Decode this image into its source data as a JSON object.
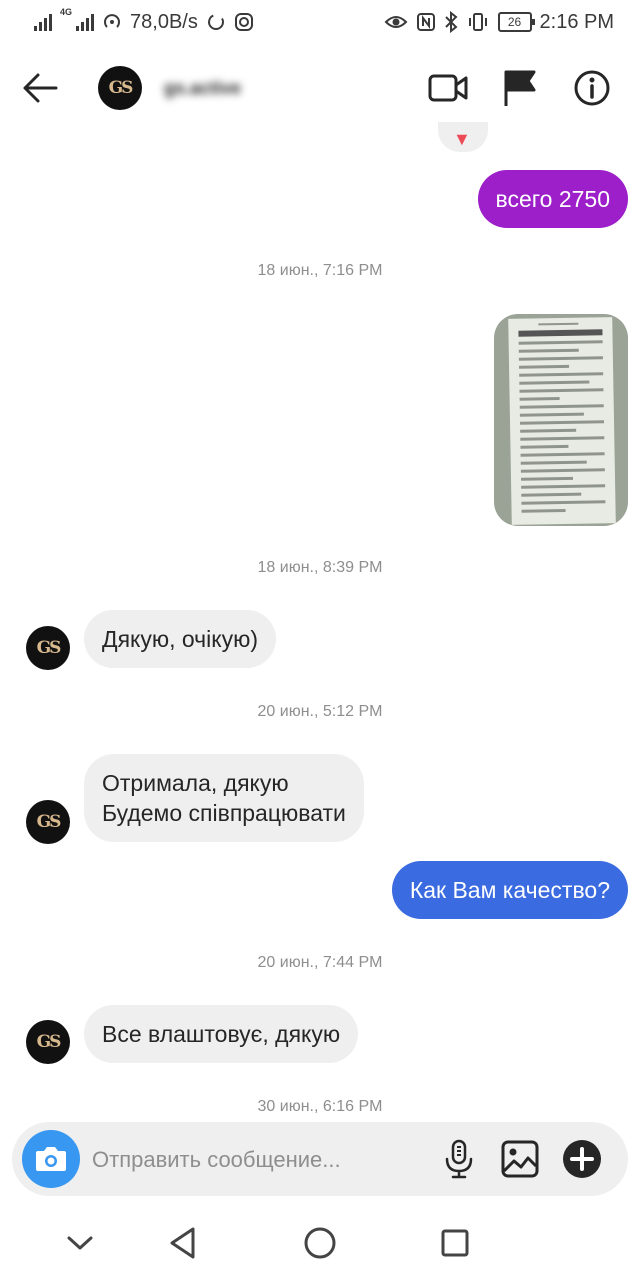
{
  "status_bar": {
    "network_type": "4G",
    "data_speed": "78,0B/s",
    "battery": "26",
    "time": "2:16 PM"
  },
  "header": {
    "username": "gs.active"
  },
  "avatar_monogram": "GS",
  "messages": [
    {
      "type": "sent",
      "text": "всего 2750"
    },
    {
      "type": "timestamp",
      "text": "18 июн., 7:16 PM"
    },
    {
      "type": "sent_image",
      "description": "receipt photo"
    },
    {
      "type": "timestamp",
      "text": "18 июн., 8:39 PM"
    },
    {
      "type": "received",
      "text": "Дякую, очікую)"
    },
    {
      "type": "timestamp",
      "text": "20 июн., 5:12 PM"
    },
    {
      "type": "received",
      "lines": [
        "Отримала, дякую",
        "Будемо співпрацювати"
      ]
    },
    {
      "type": "sent",
      "text": "Как Вам качество?"
    },
    {
      "type": "timestamp",
      "text": "20 июн., 7:44 PM"
    },
    {
      "type": "received",
      "text": "Все влаштовує, дякую"
    },
    {
      "type": "timestamp",
      "text": "30 июн., 6:16 PM"
    }
  ],
  "composer": {
    "placeholder": "Отправить сообщение..."
  },
  "colors": {
    "sent_purple": "#9c1fc9",
    "sent_blue": "#3b6be0",
    "received_bg": "#efefef",
    "camera_blue": "#3897f0"
  }
}
